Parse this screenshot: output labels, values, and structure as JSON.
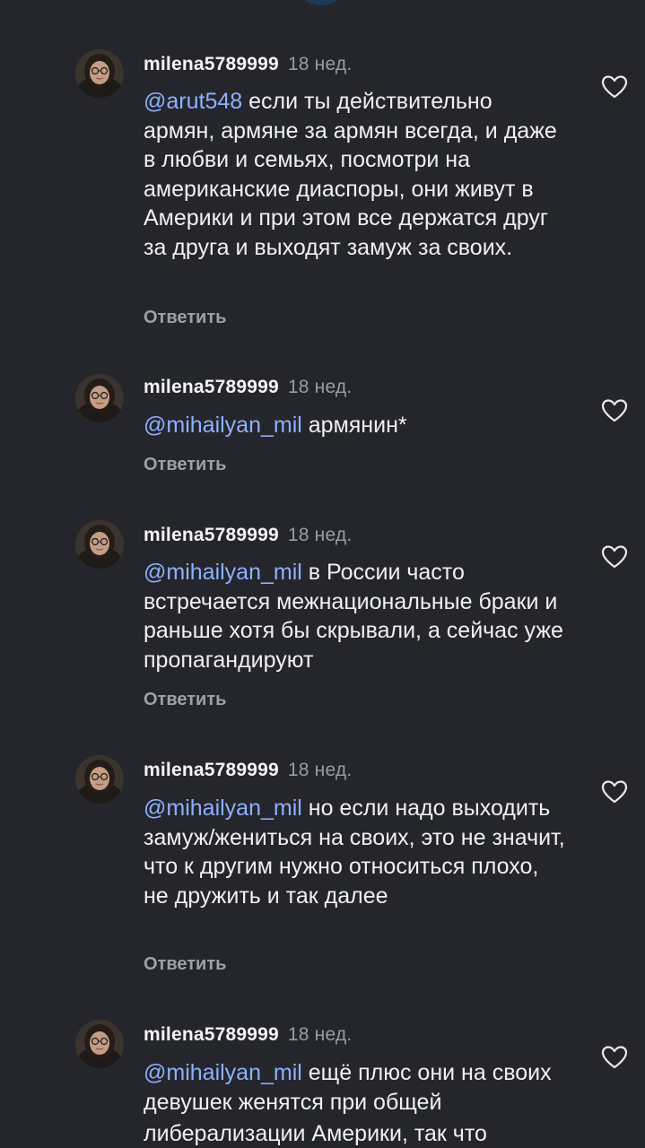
{
  "comments": [
    {
      "username": "milena5789999",
      "time": "18 нед.",
      "mention": "@arut548",
      "text": " если ты действительно армян, армяне за армян всегда, и даже в любви и семьях, посмотри на американские диаспоры, они живут в Америки и при этом все держатся друг за друга и выходят замуж за своих.",
      "reply_label": "Ответить"
    },
    {
      "username": "milena5789999",
      "time": "18 нед.",
      "mention": "@mihailyan_mil",
      "text": " армянин*",
      "reply_label": "Ответить"
    },
    {
      "username": "milena5789999",
      "time": "18 нед.",
      "mention": "@mihailyan_mil",
      "text": " в России часто встречается межнациональные браки и раньше хотя бы скрывали, а сейчас уже пропагандируют",
      "reply_label": "Ответить"
    },
    {
      "username": "milena5789999",
      "time": "18 нед.",
      "mention": "@mihailyan_mil",
      "text": " но если надо выходить замуж/жениться на своих, это не значит, что к другим нужно относиться плохо, не дружить и так далее",
      "reply_label": "Ответить"
    },
    {
      "username": "milena5789999",
      "time": "18 нед.",
      "mention": "@mihailyan_mil",
      "text": " ещё плюс они на своих девушек женятся при общей",
      "reply_label": ""
    }
  ],
  "cut_line": "либерализации Америки, так что",
  "colors": {
    "background": "#24262c",
    "mention": "#8fb0ff",
    "secondary_text": "#9ea0a6"
  },
  "icons": {
    "like": "heart-outline-icon",
    "avatar": "profile-photo-avatar"
  }
}
